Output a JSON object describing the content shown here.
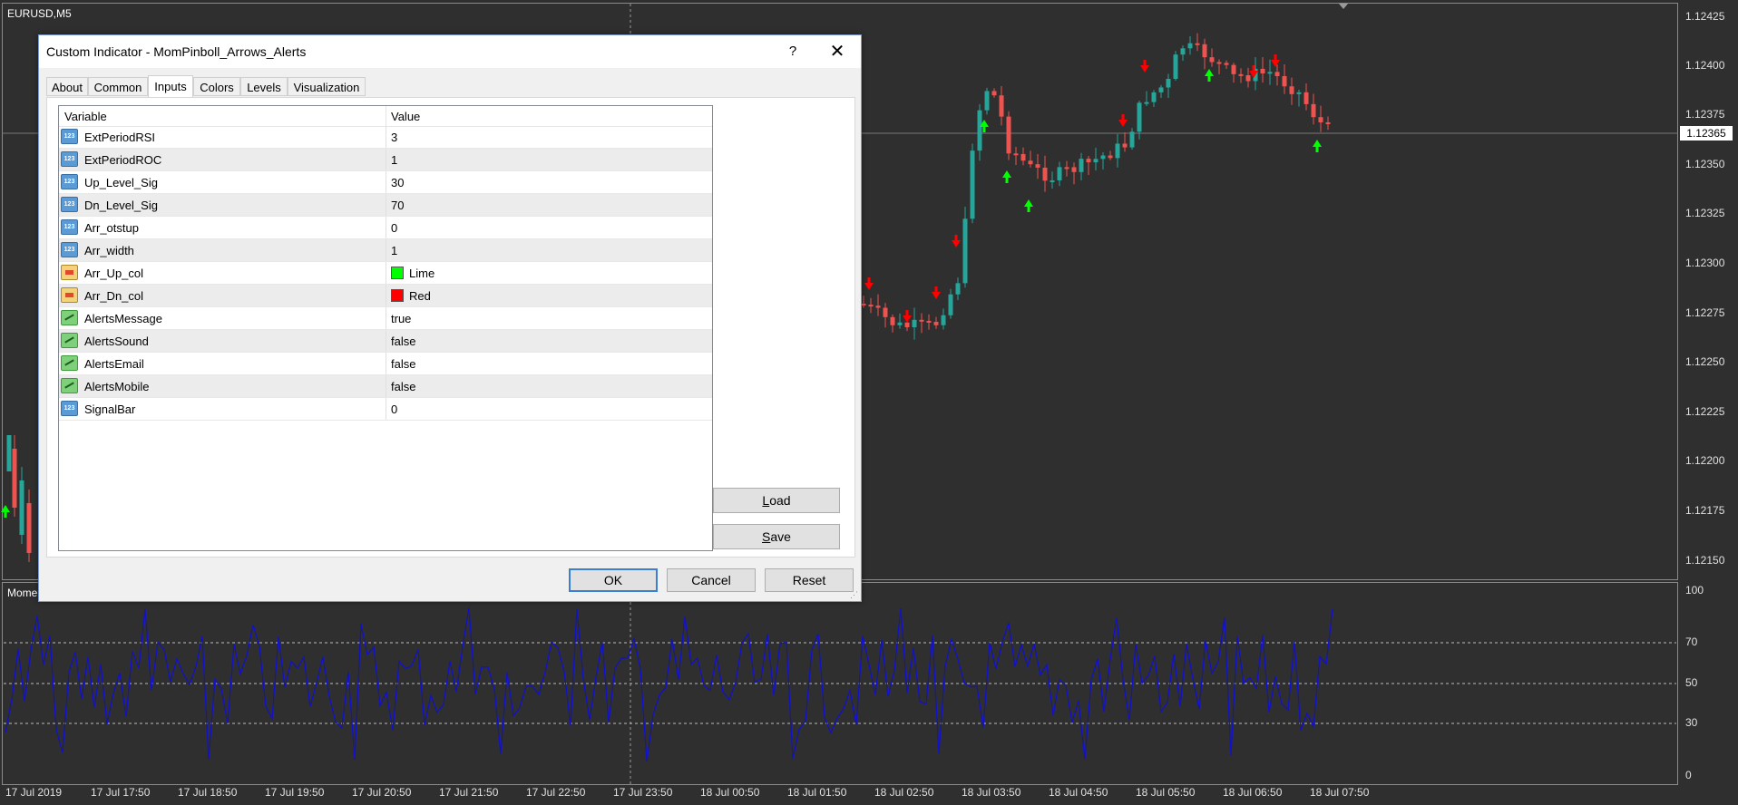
{
  "chart": {
    "symbol": "EURUSD,M5",
    "sub_window_label": "Mome",
    "price_scale": [
      "1.12425",
      "1.12400",
      "1.12375",
      "1.12350",
      "1.12325",
      "1.12300",
      "1.12275",
      "1.12250",
      "1.12225",
      "1.12200",
      "1.12175",
      "1.12150"
    ],
    "current_price": "1.12365",
    "oscillator_scale": [
      "100",
      "70",
      "50",
      "30",
      "0"
    ],
    "time_axis": [
      "17 Jul 2019",
      "17 Jul 17:50",
      "17 Jul 18:50",
      "17 Jul 19:50",
      "17 Jul 20:50",
      "17 Jul 21:50",
      "17 Jul 22:50",
      "17 Jul 23:50",
      "18 Jul 00:50",
      "18 Jul 01:50",
      "18 Jul 02:50",
      "18 Jul 03:50",
      "18 Jul 04:50",
      "18 Jul 05:50",
      "18 Jul 06:50",
      "18 Jul 07:50"
    ],
    "colors": {
      "bull": "#26a69a",
      "bear": "#ef5350",
      "up_arrow": "#00ff00",
      "dn_arrow": "#ff0000",
      "oscillator": "#1010d0",
      "background": "#2f2f2f"
    }
  },
  "dialog": {
    "title": "Custom Indicator - MomPinboll_Arrows_Alerts",
    "help": "?",
    "close": "✕",
    "tabs": [
      {
        "label": "About"
      },
      {
        "label": "Common"
      },
      {
        "label": "Inputs"
      },
      {
        "label": "Colors"
      },
      {
        "label": "Levels"
      },
      {
        "label": "Visualization"
      }
    ],
    "active_tab": "Inputs",
    "columns": {
      "variable": "Variable",
      "value": "Value"
    },
    "params": [
      {
        "name": "ExtPeriodRSI",
        "value": "3",
        "icon": "number-icon"
      },
      {
        "name": "ExtPeriodROC",
        "value": "1",
        "icon": "number-icon"
      },
      {
        "name": "Up_Level_Sig",
        "value": "30",
        "icon": "number-icon"
      },
      {
        "name": "Dn_Level_Sig",
        "value": "70",
        "icon": "number-icon"
      },
      {
        "name": "Arr_otstup",
        "value": "0",
        "icon": "number-icon"
      },
      {
        "name": "Arr_width",
        "value": "1",
        "icon": "number-icon"
      },
      {
        "name": "Arr_Up_col",
        "value": "Lime",
        "icon": "color-icon",
        "swatch": "#00ff00"
      },
      {
        "name": "Arr_Dn_col",
        "value": "Red",
        "icon": "color-icon",
        "swatch": "#ff0000"
      },
      {
        "name": "AlertsMessage",
        "value": "true",
        "icon": "boolean-icon"
      },
      {
        "name": "AlertsSound",
        "value": "false",
        "icon": "boolean-icon"
      },
      {
        "name": "AlertsEmail",
        "value": "false",
        "icon": "boolean-icon"
      },
      {
        "name": "AlertsMobile",
        "value": "false",
        "icon": "boolean-icon"
      },
      {
        "name": "SignalBar",
        "value": "0",
        "icon": "number-icon"
      }
    ],
    "buttons": {
      "load": {
        "underline": "L",
        "rest": "oad"
      },
      "save": {
        "underline": "S",
        "rest": "ave"
      },
      "ok": "OK",
      "cancel": "Cancel",
      "reset": "Reset"
    }
  }
}
